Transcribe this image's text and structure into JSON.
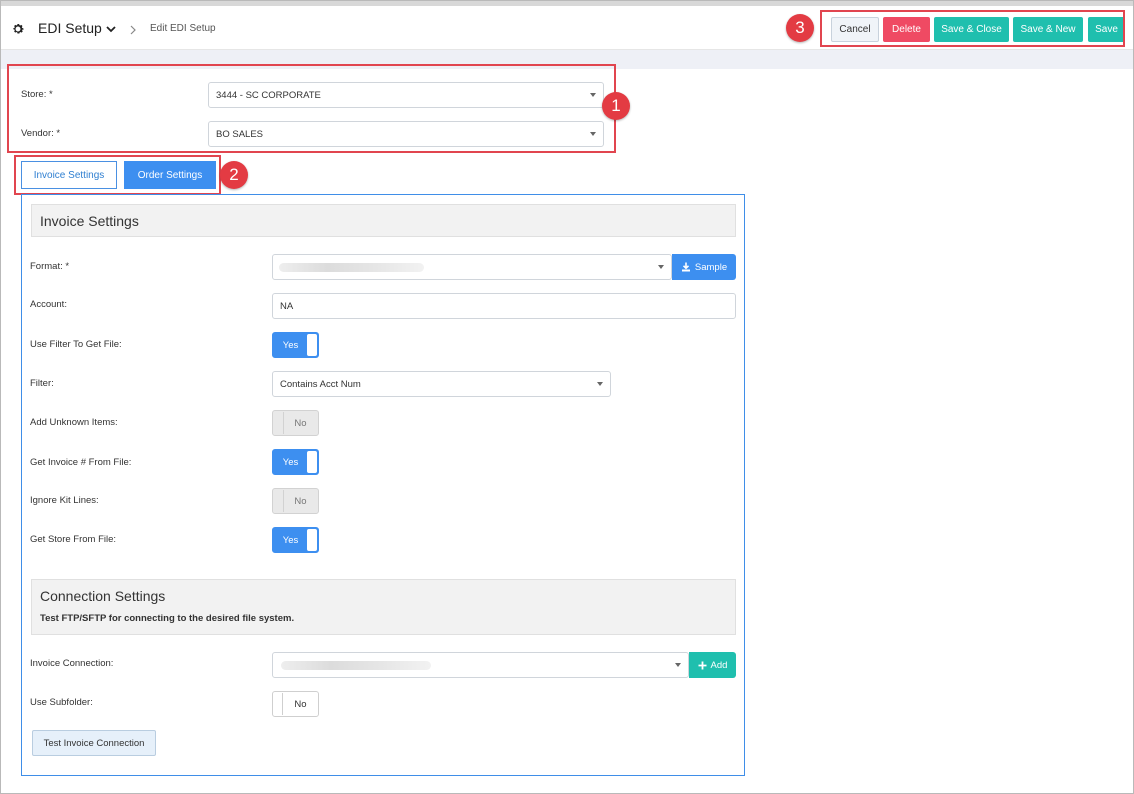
{
  "header": {
    "app_title": "EDI Setup",
    "breadcrumb": "Edit EDI Setup",
    "buttons": {
      "cancel": "Cancel",
      "delete": "Delete",
      "save_close": "Save & Close",
      "save_new": "Save & New",
      "save": "Save"
    }
  },
  "callouts": [
    "1",
    "2",
    "3"
  ],
  "form": {
    "store_label": "Store: *",
    "store_value": "3444 - SC CORPORATE",
    "vendor_label": "Vendor: *",
    "vendor_value": "BO SALES"
  },
  "tabs": [
    {
      "label": "Invoice Settings",
      "active": true
    },
    {
      "label": "Order Settings",
      "active": false
    }
  ],
  "invoice_settings": {
    "title": "Invoice Settings",
    "format_label": "Format: *",
    "format_value": "",
    "sample_button": "Sample",
    "account_label": "Account:",
    "account_value": "NA",
    "use_filter_label": "Use Filter To Get File:",
    "use_filter_value": "Yes",
    "filter_label": "Filter:",
    "filter_value": "Contains Acct Num",
    "add_unknown_label": "Add Unknown Items:",
    "add_unknown_value": "No",
    "get_invoice_label": "Get Invoice # From File:",
    "get_invoice_value": "Yes",
    "ignore_kit_label": "Ignore Kit Lines:",
    "ignore_kit_value": "No",
    "get_store_label": "Get Store From File:",
    "get_store_value": "Yes"
  },
  "connection_settings": {
    "title": "Connection Settings",
    "subtitle": "Test FTP/SFTP for connecting to the desired file system.",
    "invoice_connection_label": "Invoice Connection:",
    "invoice_connection_value": "",
    "add_button": "Add",
    "use_subfolder_label": "Use Subfolder:",
    "use_subfolder_value": "No",
    "test_button": "Test Invoice Connection"
  },
  "colors": {
    "primary_blue": "#3d8ff0",
    "teal": "#1fbfae",
    "delete_red": "#ef4a63",
    "callout_red": "#e33b43"
  },
  "icons": [
    "gear-icon",
    "chevron-down-icon",
    "chevron-right-icon",
    "download-icon",
    "plus-icon",
    "caret-down-icon"
  ]
}
